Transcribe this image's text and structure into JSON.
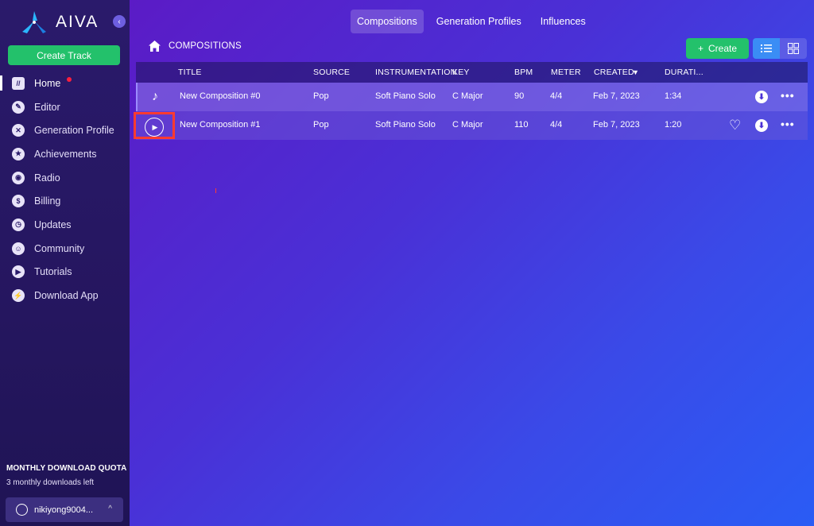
{
  "app": {
    "name": "AIVA",
    "collapse_glyph": "‹"
  },
  "sidebar": {
    "create_label": "Create Track",
    "items": [
      {
        "label": "Home",
        "icon": "home-icon",
        "glyph": "//",
        "active": true,
        "badge": true
      },
      {
        "label": "Editor",
        "icon": "pencil-icon",
        "glyph": "✎"
      },
      {
        "label": "Generation Profile",
        "icon": "sliders-icon",
        "glyph": "✕"
      },
      {
        "label": "Achievements",
        "icon": "medal-icon",
        "glyph": "★"
      },
      {
        "label": "Radio",
        "icon": "radio-icon",
        "glyph": "◉"
      },
      {
        "label": "Billing",
        "icon": "dollar-icon",
        "glyph": "$"
      },
      {
        "label": "Updates",
        "icon": "clock-icon",
        "glyph": "◷"
      },
      {
        "label": "Community",
        "icon": "discord-icon",
        "glyph": "☺"
      },
      {
        "label": "Tutorials",
        "icon": "play-icon",
        "glyph": "▶"
      },
      {
        "label": "Download App",
        "icon": "download-app-icon",
        "glyph": "⚡"
      }
    ],
    "quota_title": "MONTHLY DOWNLOAD QUOTA",
    "quota_text": "3 monthly downloads left",
    "user_name": "nikiyong9004...",
    "user_caret": "^"
  },
  "tabs": [
    "Compositions",
    "Generation Profiles",
    "Influences"
  ],
  "breadcrumb": "COMPOSITIONS",
  "toolbar": {
    "create_label": "Create",
    "create_plus": "+"
  },
  "table": {
    "headers": {
      "title": "TITLE",
      "source": "SOURCE",
      "instrumentation": "INSTRUMENTATION",
      "key": "KEY",
      "bpm": "BPM",
      "meter": "METER",
      "created": "CREATED",
      "sort_arrow": "▼",
      "duration": "DURATI..."
    },
    "rows": [
      {
        "title": "New Composition #0",
        "source": "Pop",
        "instrumentation": "Soft Piano Solo",
        "key": "C Major",
        "bpm": "90",
        "meter": "4/4",
        "created": "Feb 7, 2023",
        "duration": "1:34"
      },
      {
        "title": "New Composition #1",
        "source": "Pop",
        "instrumentation": "Soft Piano Solo",
        "key": "C Major",
        "bpm": "110",
        "meter": "4/4",
        "created": "Feb 7, 2023",
        "duration": "1:20"
      }
    ],
    "glyphs": {
      "note": "♪",
      "play": "▶",
      "download": "⬇",
      "more": "•••",
      "heart": "♡"
    }
  },
  "colors": {
    "accent_green": "#23c16b",
    "accent_blue": "#3a8df5",
    "highlight_red": "#ff3b30"
  }
}
